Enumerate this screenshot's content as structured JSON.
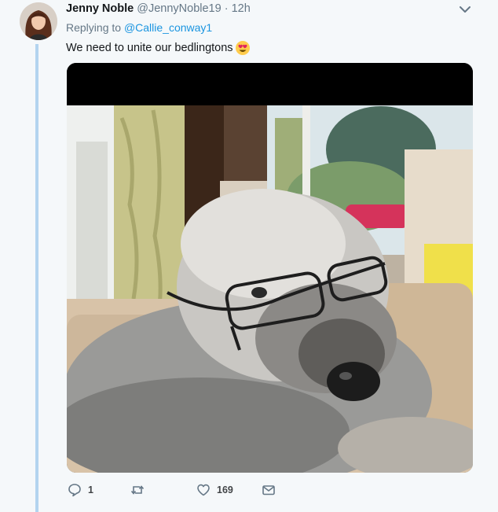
{
  "tweet": {
    "display_name": "Jenny Noble",
    "handle": "@JennyNoble19",
    "separator": "·",
    "time": "12h",
    "replying_prefix": "Replying to",
    "replying_to": "@Callie_conway1",
    "text": "We need to unite our bedlingtons",
    "emoji": "heart-eyes-emoji"
  },
  "actions": {
    "reply_count": "1",
    "retweet_count": "",
    "like_count": "169"
  },
  "icons": {
    "more": "chevron-down-icon",
    "reply": "reply-icon",
    "retweet": "retweet-icon",
    "like": "heart-icon",
    "dm": "envelope-icon"
  },
  "colors": {
    "link": "#1b95e0",
    "muted": "#657786",
    "thread_line": "#b3d4ef",
    "background": "#f5f8fa"
  }
}
